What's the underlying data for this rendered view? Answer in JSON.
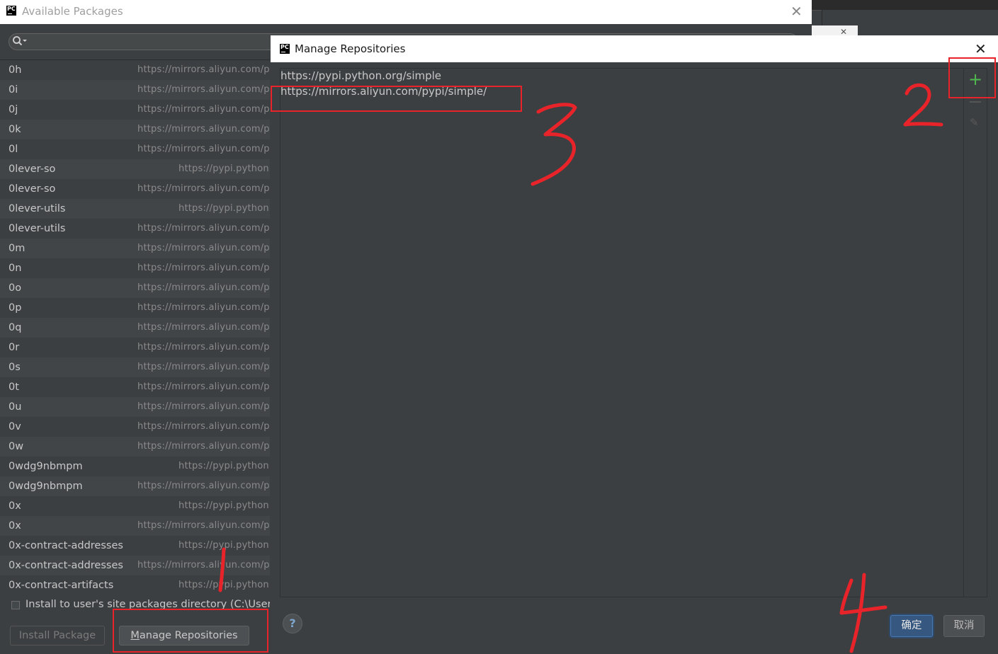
{
  "available_packages": {
    "title": "Available Packages",
    "close_glyph": "✕",
    "search_icon": "🔍",
    "packages": [
      {
        "name": "0h",
        "repo": "https://mirrors.aliyun.com/pypi/simple/"
      },
      {
        "name": "0i",
        "repo": "https://mirrors.aliyun.com/pypi/simple/"
      },
      {
        "name": "0j",
        "repo": "https://mirrors.aliyun.com/pypi/simple/"
      },
      {
        "name": "0k",
        "repo": "https://mirrors.aliyun.com/pypi/simple/"
      },
      {
        "name": "0l",
        "repo": "https://mirrors.aliyun.com/pypi/simple/"
      },
      {
        "name": "0lever-so",
        "repo": "https://pypi.python.org/simple"
      },
      {
        "name": "0lever-so",
        "repo": "https://mirrors.aliyun.com/pypi/simple/"
      },
      {
        "name": "0lever-utils",
        "repo": "https://pypi.python.org/simple"
      },
      {
        "name": "0lever-utils",
        "repo": "https://mirrors.aliyun.com/pypi/simple/"
      },
      {
        "name": "0m",
        "repo": "https://mirrors.aliyun.com/pypi/simple/"
      },
      {
        "name": "0n",
        "repo": "https://mirrors.aliyun.com/pypi/simple/"
      },
      {
        "name": "0o",
        "repo": "https://mirrors.aliyun.com/pypi/simple/"
      },
      {
        "name": "0p",
        "repo": "https://mirrors.aliyun.com/pypi/simple/"
      },
      {
        "name": "0q",
        "repo": "https://mirrors.aliyun.com/pypi/simple/"
      },
      {
        "name": "0r",
        "repo": "https://mirrors.aliyun.com/pypi/simple/"
      },
      {
        "name": "0s",
        "repo": "https://mirrors.aliyun.com/pypi/simple/"
      },
      {
        "name": "0t",
        "repo": "https://mirrors.aliyun.com/pypi/simple/"
      },
      {
        "name": "0u",
        "repo": "https://mirrors.aliyun.com/pypi/simple/"
      },
      {
        "name": "0v",
        "repo": "https://mirrors.aliyun.com/pypi/simple/"
      },
      {
        "name": "0w",
        "repo": "https://mirrors.aliyun.com/pypi/simple/"
      },
      {
        "name": "0wdg9nbmpm",
        "repo": "https://pypi.python.org/simple"
      },
      {
        "name": "0wdg9nbmpm",
        "repo": "https://mirrors.aliyun.com/pypi/simple/"
      },
      {
        "name": "0x",
        "repo": "https://pypi.python.org/simple"
      },
      {
        "name": "0x",
        "repo": "https://mirrors.aliyun.com/pypi/simple/"
      },
      {
        "name": "0x-contract-addresses",
        "repo": "https://pypi.python.org/simple"
      },
      {
        "name": "0x-contract-addresses",
        "repo": "https://mirrors.aliyun.com/pypi/simple/"
      },
      {
        "name": "0x-contract-artifacts",
        "repo": "https://pypi.python.org/simple"
      }
    ],
    "install_user_site_label": "Install to user's site packages directory (C:\\Users",
    "install_button": "Install Package",
    "manage_repositories_button": "Manage Repositories"
  },
  "manage_repositories": {
    "title": "Manage Repositories",
    "close_glyph": "✕",
    "repositories": [
      "https://pypi.python.org/simple",
      "https://mirrors.aliyun.com/pypi/simple/"
    ],
    "add_glyph": "+",
    "edit_glyph": "✎",
    "help_glyph": "?",
    "ok_button": "确定",
    "cancel_button": "取消"
  },
  "app_logo_text": "PC",
  "annotations": {
    "color": "#e8242a",
    "step_labels": [
      "1",
      "2",
      "3",
      "4"
    ]
  },
  "colors": {
    "dialog_bg": "#3c3f41",
    "ok_button_bg": "#365880",
    "add_icon": "#4fb84f"
  }
}
